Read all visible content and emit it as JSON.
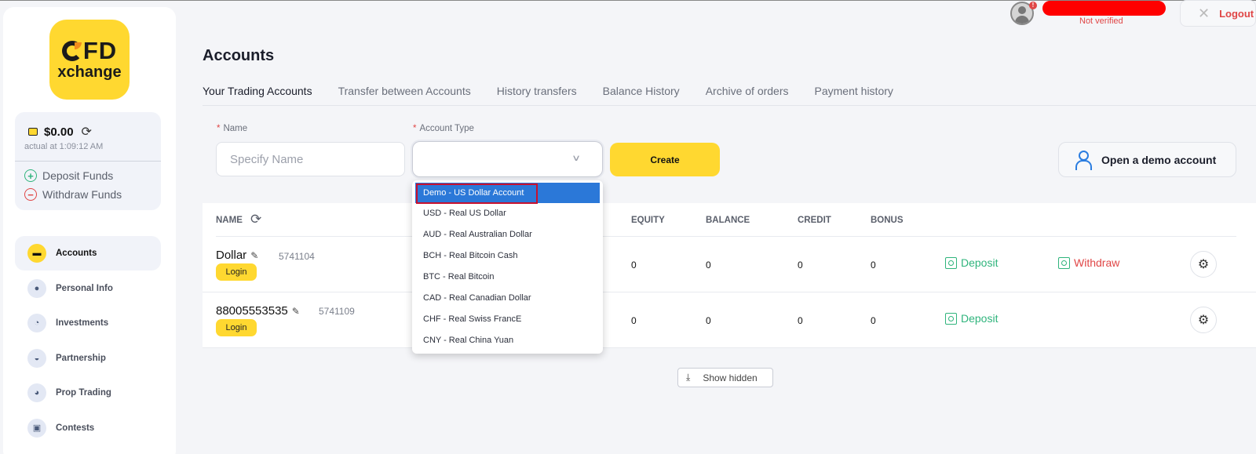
{
  "header": {
    "status": "Not verified",
    "logout_label": "Logout",
    "alert_glyph": "!"
  },
  "sidebar": {
    "logo_line1": "FD",
    "logo_line2": "xchange",
    "balance": "$0.00",
    "balance_time": "actual at 1:09:12 AM",
    "deposit_funds": "Deposit Funds",
    "withdraw_funds": "Withdraw Funds",
    "nav": [
      {
        "label": "Accounts",
        "icon": "wallet-icon"
      },
      {
        "label": "Personal Info",
        "icon": "person-icon"
      },
      {
        "label": "Investments",
        "icon": "chart-icon"
      },
      {
        "label": "Partnership",
        "icon": "handshake-icon"
      },
      {
        "label": "Prop Trading",
        "icon": "pie-icon"
      },
      {
        "label": "Contests",
        "icon": "gift-icon"
      }
    ]
  },
  "page": {
    "title": "Accounts",
    "tabs": [
      "Your Trading Accounts",
      "Transfer between Accounts",
      "History transfers",
      "Balance History",
      "Archive of orders",
      "Payment history"
    ],
    "active_tab": "Your Trading Accounts"
  },
  "form": {
    "name_label": "Name",
    "name_placeholder": "Specify Name",
    "type_label": "Account Type",
    "create_label": "Create",
    "demo_label": "Open a demo account",
    "required_mark": "*"
  },
  "dropdown": {
    "options": [
      "Demo - US Dollar Account",
      "USD - Real US Dollar",
      "AUD - Real Australian Dollar",
      "BCH - Real Bitcoin Cash",
      "BTC - Real Bitcoin",
      "CAD - Real Canadian Dollar",
      "CHF - Real Swiss FrancE",
      "CNY - Real China Yuan"
    ],
    "highlighted": "Demo - US Dollar Account"
  },
  "table": {
    "columns": [
      "NAME",
      "EQUITY",
      "BALANCE",
      "CREDIT",
      "BONUS"
    ],
    "login_label": "Login",
    "deposit_label": "Deposit",
    "withdraw_label": "Withdraw",
    "rows": [
      {
        "name": "Dollar",
        "number": "5741104",
        "equity": "0",
        "balance": "0",
        "credit": "0",
        "bonus": "0",
        "withdraw": true
      },
      {
        "name": "88005553535",
        "number": "5741109",
        "equity": "0",
        "balance": "0",
        "credit": "0",
        "bonus": "0",
        "withdraw": false
      }
    ]
  },
  "show_hidden_label": "Show hidden",
  "colors": {
    "brand_yellow": "#ffd830",
    "deposit_green": "#2fb47c",
    "withdraw_red": "#e04646",
    "selected_blue": "#2b78d8",
    "page_bg": "#f4f5f8"
  }
}
